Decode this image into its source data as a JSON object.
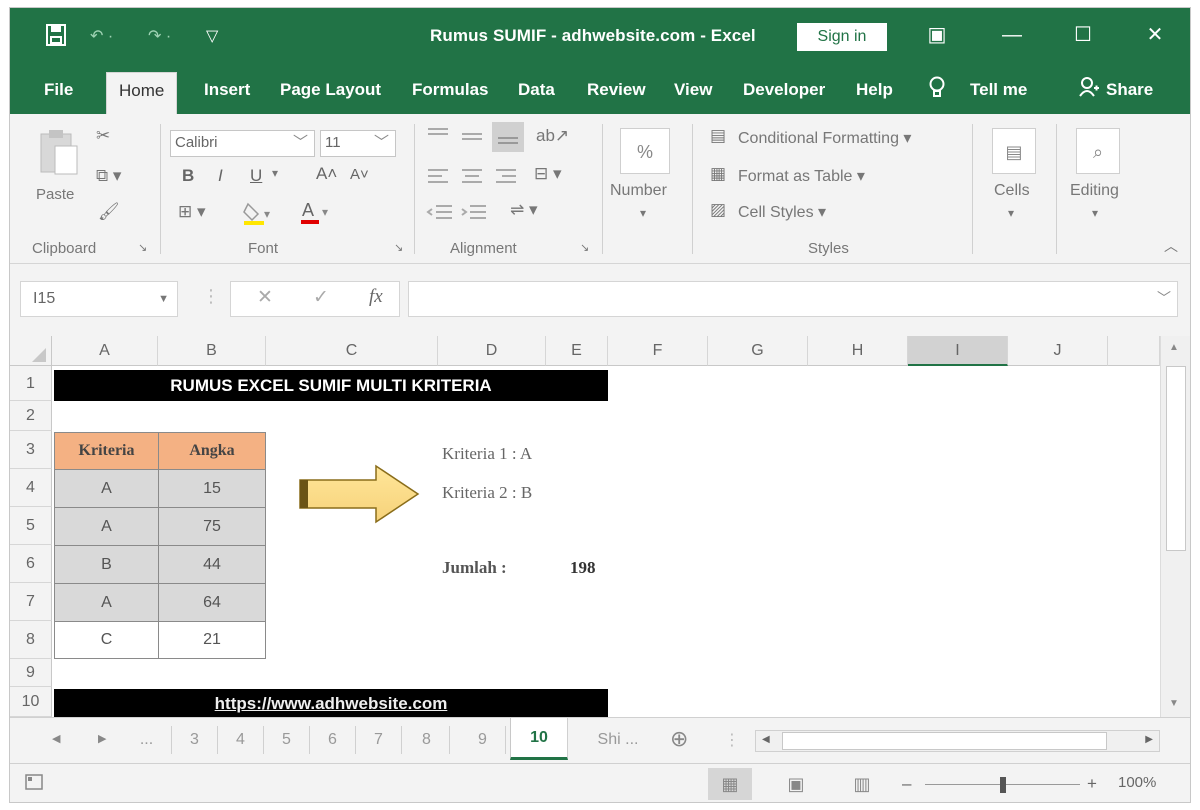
{
  "window": {
    "title": "Rumus SUMIF - adhwebsite.com  -  Excel",
    "sign_in": "Sign in",
    "minimize": "—",
    "maximize": "☐",
    "close": "✕",
    "ribbon_display": "▣"
  },
  "qat": {
    "save_icon": "save-icon",
    "undo": "↶ ·",
    "redo": "↷ ·",
    "customize": "▽"
  },
  "tabs": [
    {
      "label": "File"
    },
    {
      "label": "Home"
    },
    {
      "label": "Insert"
    },
    {
      "label": "Page Layout"
    },
    {
      "label": "Formulas"
    },
    {
      "label": "Data"
    },
    {
      "label": "Review"
    },
    {
      "label": "View"
    },
    {
      "label": "Developer"
    },
    {
      "label": "Help"
    }
  ],
  "tell_me": "Tell me",
  "share": "Share",
  "ribbon": {
    "clipboard": {
      "paste": "Paste",
      "label": "Clipboard"
    },
    "font": {
      "name": "Calibri",
      "size": "11",
      "bold": "B",
      "italic": "I",
      "underline": "U",
      "grow": "A˄",
      "shrink": "A˅",
      "label": "Font"
    },
    "alignment": {
      "label": "Alignment"
    },
    "number": {
      "percent": "%",
      "label": "Number"
    },
    "styles": {
      "conditional": "Conditional Formatting ▾",
      "format_table": "Format as Table ▾",
      "cell_styles": "Cell Styles ▾",
      "label": "Styles"
    },
    "cells": {
      "label": "Cells"
    },
    "editing": {
      "label": "Editing"
    }
  },
  "formula_bar": {
    "name_box": "I15",
    "cancel": "✕",
    "enter": "✓",
    "fx": "fx",
    "value": ""
  },
  "columns": [
    "A",
    "B",
    "C",
    "D",
    "E",
    "F",
    "G",
    "H",
    "I",
    "J"
  ],
  "selected_column": "I",
  "rows": [
    "1",
    "2",
    "3",
    "4",
    "5",
    "6",
    "7",
    "8",
    "9",
    "10"
  ],
  "sheet": {
    "title_banner": "RUMUS EXCEL SUMIF MULTI KRITERIA",
    "table_headers": [
      "Kriteria",
      "Angka"
    ],
    "table_rows": [
      {
        "kriteria": "A",
        "angka": "15"
      },
      {
        "kriteria": "A",
        "angka": "75"
      },
      {
        "kriteria": "B",
        "angka": "44"
      },
      {
        "kriteria": "A",
        "angka": "64"
      },
      {
        "kriteria": "C",
        "angka": "21"
      }
    ],
    "kriteria1": "Kriteria 1 : A",
    "kriteria2": "Kriteria 2 : B",
    "jumlah_label": "Jumlah :",
    "jumlah_value": "198",
    "footer_link": "https://www.adhwebsite.com"
  },
  "sheet_tabs": {
    "ellipsis": "...",
    "tabs": [
      "3",
      "4",
      "5",
      "6",
      "7",
      "8",
      "9",
      "10",
      "Shi ..."
    ],
    "active": "10",
    "add": "⊕"
  },
  "status_bar": {
    "zoom": "100%",
    "zoom_level_percent": 100,
    "minus": "–",
    "plus": "+"
  },
  "colors": {
    "excel_green": "#217346",
    "header_fill": "#f4b183",
    "gray_fill": "#d9d9d9",
    "arrow_fill": "#ffe699"
  }
}
